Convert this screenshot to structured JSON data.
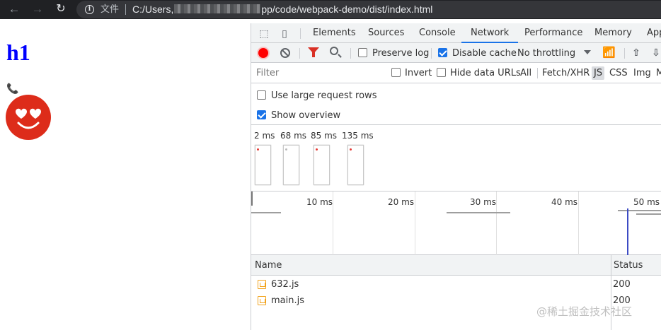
{
  "browser": {
    "back_icon": "arrow-left-icon",
    "forward_icon": "arrow-right-icon",
    "reload_icon": "reload-icon",
    "file_label": "文件",
    "url_prefix": "C:/Users,",
    "url_suffix": "pp/code/webpack-demo/dist/index.html"
  },
  "page": {
    "heading": "h1",
    "phone_glyph": "📞",
    "emoji_icon": "heart-eyes-smiley-icon",
    "emoji_color": "#dd2c1a"
  },
  "devtools": {
    "tabs": [
      {
        "label": "Elements"
      },
      {
        "label": "Sources"
      },
      {
        "label": "Console"
      },
      {
        "label": "Network"
      },
      {
        "label": "Performance"
      },
      {
        "label": "Memory"
      },
      {
        "label": "App"
      }
    ],
    "active_tab": "Network",
    "accent": "#1a73e8",
    "toolbar": {
      "preserve_log": "Preserve log",
      "preserve_log_checked": false,
      "disable_cache": "Disable cache",
      "disable_cache_checked": true,
      "throttling": "No throttling"
    },
    "filter": {
      "placeholder": "Filter",
      "invert": "Invert",
      "hide_data_urls": "Hide data URLs",
      "types": [
        "All",
        "Fetch/XHR",
        "JS",
        "CSS",
        "Img",
        "M"
      ],
      "active_type": "JS"
    },
    "options": {
      "large_rows": "Use large request rows",
      "large_rows_checked": false,
      "show_overview": "Show overview",
      "show_overview_checked": true
    },
    "filmstrip": [
      "2 ms",
      "68 ms",
      "85 ms",
      "135 ms"
    ],
    "overview_ticks": [
      "10 ms",
      "20 ms",
      "30 ms",
      "40 ms",
      "50 ms"
    ],
    "table": {
      "columns": [
        "Name",
        "Status"
      ],
      "rows": [
        {
          "name": "632.js",
          "status": "200"
        },
        {
          "name": "main.js",
          "status": "200"
        }
      ]
    }
  },
  "watermark": "@稀土掘金技术社区"
}
